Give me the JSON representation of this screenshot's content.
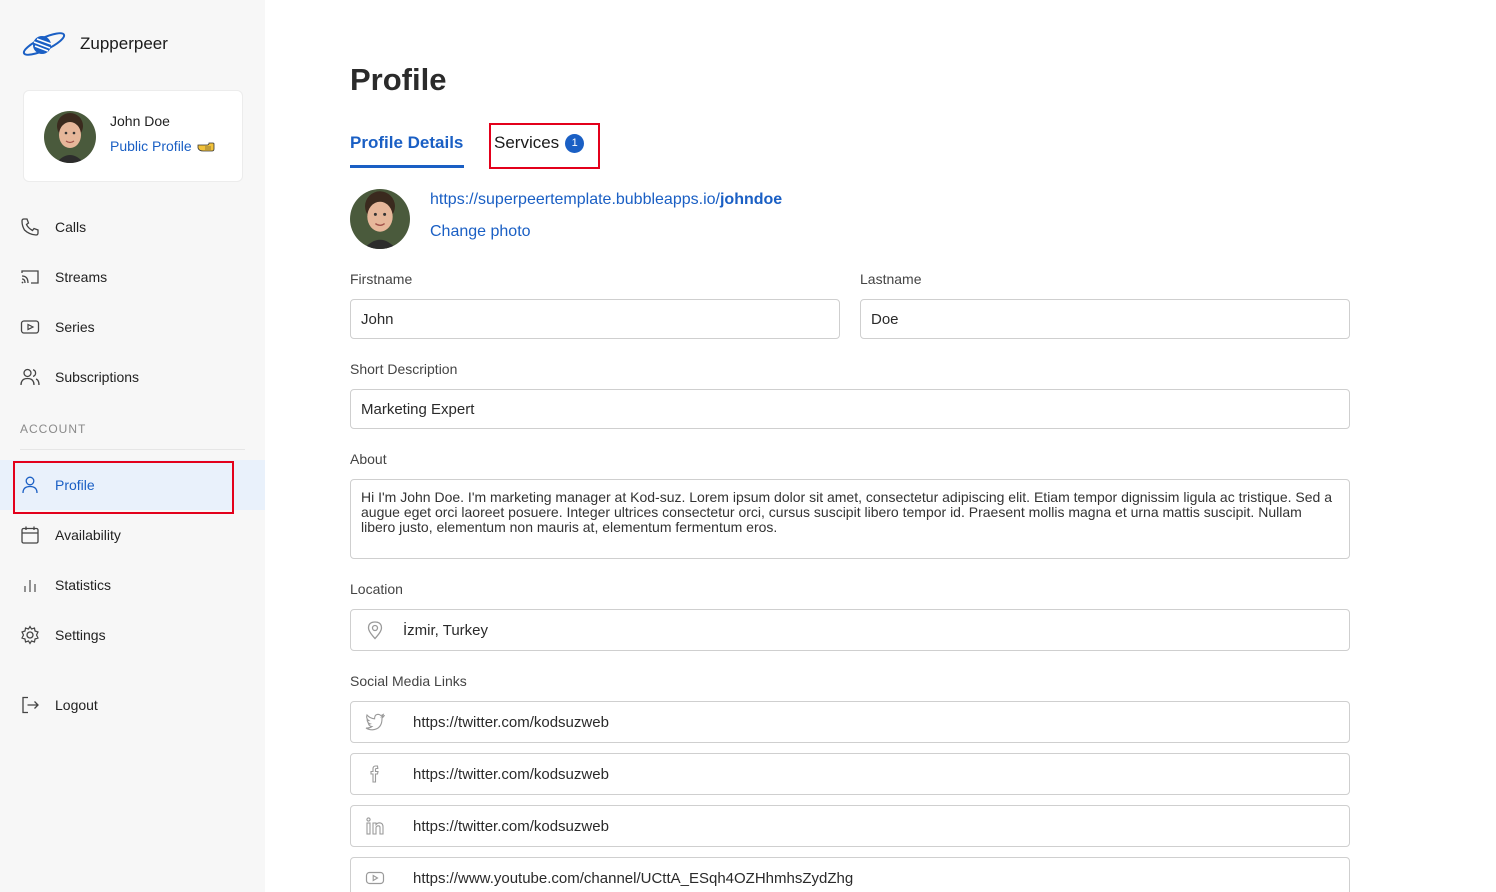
{
  "app": {
    "name": "Zupperpeer"
  },
  "user": {
    "name": "John Doe",
    "public_profile_label": "Public Profile"
  },
  "nav": {
    "items": [
      {
        "label": "Calls",
        "icon": "phone-icon"
      },
      {
        "label": "Streams",
        "icon": "cast-icon"
      },
      {
        "label": "Series",
        "icon": "play-box-icon"
      },
      {
        "label": "Subscriptions",
        "icon": "users-icon"
      }
    ],
    "section_account": "ACCOUNT",
    "account_items": [
      {
        "label": "Profile",
        "icon": "user-icon",
        "active": true
      },
      {
        "label": "Availability",
        "icon": "calendar-icon"
      },
      {
        "label": "Statistics",
        "icon": "bar-chart-icon"
      },
      {
        "label": "Settings",
        "icon": "gear-icon"
      }
    ],
    "logout": {
      "label": "Logout",
      "icon": "logout-icon"
    }
  },
  "page": {
    "title": "Profile",
    "tabs": [
      {
        "label": "Profile Details",
        "active": true
      },
      {
        "label": "Services",
        "badge": "1"
      }
    ],
    "profile_url_prefix": "https://superpeertemplate.bubbleapps.io/",
    "profile_url_handle": "johndoe",
    "change_photo": "Change photo"
  },
  "form": {
    "firstname_label": "Firstname",
    "firstname_value": "John",
    "lastname_label": "Lastname",
    "lastname_value": "Doe",
    "short_description_label": "Short Description",
    "short_description_value": "Marketing Expert",
    "about_label": "About",
    "about_value": "Hi I'm John Doe. I'm marketing manager at Kod-suz. Lorem ipsum dolor sit amet, consectetur adipiscing elit. Etiam tempor dignissim ligula ac tristique. Sed a augue eget orci laoreet posuere. Integer ultrices consectetur orci, cursus suscipit libero tempor id. Praesent mollis magna et urna mattis suscipit. Nullam libero justo, elementum non mauris at, elementum fermentum eros.",
    "location_label": "Location",
    "location_value": "İzmir, Turkey",
    "social_label": "Social Media Links",
    "social_links": [
      {
        "icon": "twitter-icon",
        "value": "https://twitter.com/kodsuzweb"
      },
      {
        "icon": "facebook-icon",
        "value": "https://twitter.com/kodsuzweb"
      },
      {
        "icon": "linkedin-icon",
        "value": "https://twitter.com/kodsuzweb"
      },
      {
        "icon": "youtube-icon",
        "value": "https://www.youtube.com/channel/UCttA_ESqh4OZHhmhsZydZhg"
      }
    ]
  },
  "colors": {
    "accent": "#1a5fc4",
    "highlight": "#e3001b",
    "sidebar_bg": "#f7f7f7",
    "active_bg": "#e9f1fb"
  }
}
